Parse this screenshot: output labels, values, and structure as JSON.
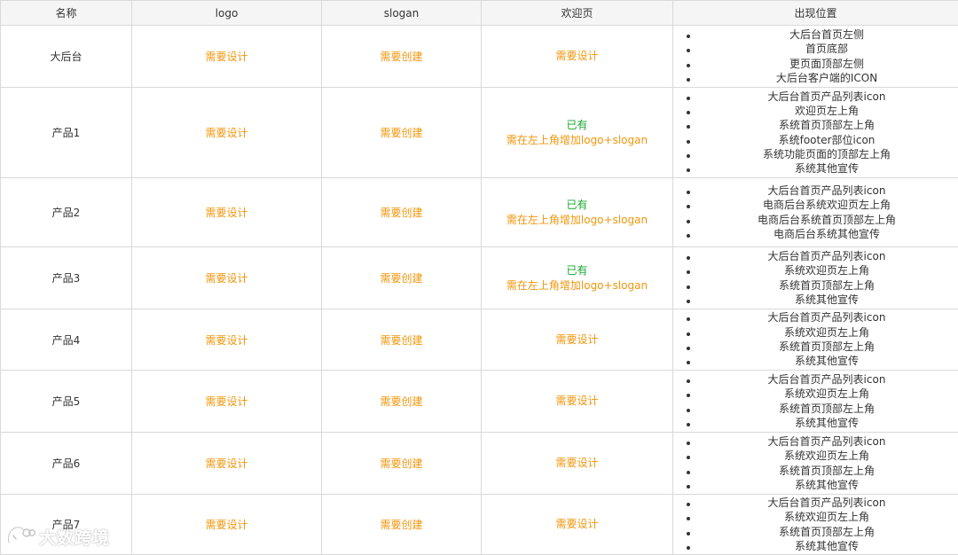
{
  "headers": [
    "名称",
    "logo",
    "slogan",
    "欢迎页",
    "出现位置"
  ],
  "rows": [
    {
      "name": "大后台",
      "logo": "需要设计",
      "slogan": "需要创建",
      "welcome": [
        "需要设计"
      ],
      "positions": [
        "大后台首页左侧",
        "首页底部",
        "更页面顶部左侧",
        "大后台客户端的ICON"
      ]
    },
    {
      "name": "产品1",
      "logo": "需要设计",
      "slogan": "需要创建",
      "welcome": [
        "已有",
        "需在左上角增加logo+slogan"
      ],
      "positions": [
        "大后台首页产品列表icon",
        "欢迎页左上角",
        "系统首页顶部左上角",
        "系统footer部位icon",
        "系统功能页面的顶部左上角",
        "系统其他宣传"
      ]
    },
    {
      "name": "产品2",
      "logo": "需要设计",
      "slogan": "需要创建",
      "welcome": [
        "已有",
        "需在左上角增加logo+slogan"
      ],
      "positions": [
        "大后台首页产品列表icon",
        "电商后台系统欢迎页左上角",
        "电商后台系统首页顶部左上角",
        "电商后台系统其他宣传"
      ]
    },
    {
      "name": "产品3",
      "logo": "需要设计",
      "slogan": "需要创建",
      "welcome": [
        "已有",
        "需在左上角增加logo+slogan"
      ],
      "positions": [
        "大后台首页产品列表icon",
        "系统欢迎页左上角",
        "系统首页顶部左上角",
        "系统其他宣传"
      ]
    },
    {
      "name": "产品4",
      "logo": "需要设计",
      "slogan": "需要创建",
      "welcome": [
        "需要设计"
      ],
      "positions": [
        "大后台首页产品列表icon",
        "系统欢迎页左上角",
        "系统首页顶部左上角",
        "系统其他宣传"
      ]
    },
    {
      "name": "产品5",
      "logo": "需要设计",
      "slogan": "需要创建",
      "welcome": [
        "需要设计"
      ],
      "positions": [
        "大后台首页产品列表icon",
        "系统欢迎页左上角",
        "系统首页顶部左上角",
        "系统其他宣传"
      ]
    },
    {
      "name": "产品6",
      "logo": "需要设计",
      "slogan": "需要创建",
      "welcome": [
        "需要设计"
      ],
      "positions": [
        "大后台首页产品列表icon",
        "系统欢迎页左上角",
        "系统首页顶部左上角",
        "系统其他宣传"
      ]
    },
    {
      "name": "产品7",
      "logo": "需要设计",
      "slogan": "需要创建",
      "welcome": [
        "需要设计"
      ],
      "positions": [
        "大后台首页产品列表icon",
        "系统欢迎页左上角",
        "系统首页顶部左上角",
        "系统其他宣传"
      ]
    }
  ],
  "colors": {
    "pending": "#f0960c",
    "existing": "#16a52d",
    "header_bg": "#f5f5f5",
    "border": "#d9d9d9"
  },
  "watermark": {
    "text": "大数跨境",
    "icon": "tiger-logo-icon"
  }
}
